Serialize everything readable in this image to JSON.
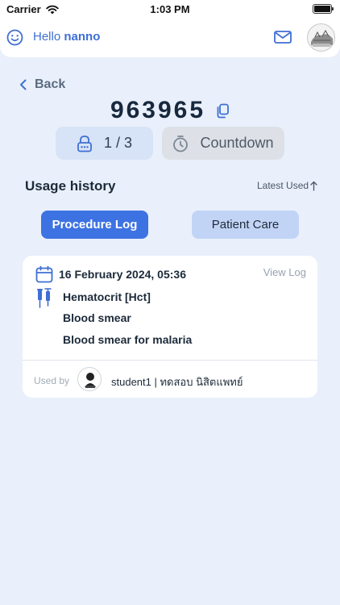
{
  "status_bar": {
    "carrier": "Carrier",
    "time": "1:03 PM"
  },
  "header": {
    "greeting": "Hello",
    "user_name": "nanno"
  },
  "nav": {
    "back_label": "Back"
  },
  "code": {
    "value": "963965"
  },
  "counter": {
    "value": "1 / 3"
  },
  "countdown": {
    "label": "Countdown"
  },
  "usage_history": {
    "title": "Usage history",
    "sort_label": "Latest Used",
    "tabs": [
      {
        "label": "Procedure Log",
        "active": true
      },
      {
        "label": "Patient Care",
        "active": false
      }
    ],
    "log": {
      "date": "16 February 2024,  05:36",
      "view_log_label": "View Log",
      "procedures": [
        "Hematocrit [Hct]",
        "Blood smear",
        "Blood smear for malaria"
      ],
      "used_by_label": "Used by",
      "user": "student1  |  ทดสอบ นิสิตแพทย์"
    }
  },
  "colors": {
    "accent": "#3d72e3",
    "background": "#e9f0fb",
    "tab_inactive": "#c2d4f6"
  }
}
